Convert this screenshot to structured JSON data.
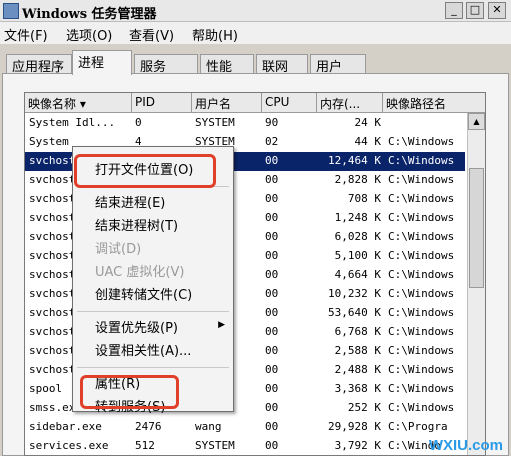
{
  "window": {
    "title": "Windows 任务管理器"
  },
  "menubar": [
    "文件(F)",
    "选项(O)",
    "查看(V)",
    "帮助(H)"
  ],
  "tabs": [
    "应用程序",
    "进程",
    "服务",
    "性能",
    "联网",
    "用户"
  ],
  "active_tab": "进程",
  "columns": [
    "映像名称",
    "PID",
    "用户名",
    "CPU",
    "内存(...",
    "映像路径名"
  ],
  "rows": [
    {
      "name": "System Idl...",
      "pid": "0",
      "user": "SYSTEM",
      "cpu": "90",
      "mem": "24 K",
      "path": ""
    },
    {
      "name": "System",
      "pid": "4",
      "user": "SYSTEM",
      "cpu": "02",
      "mem": "44 K",
      "path": "C:\\Windows"
    },
    {
      "name": "svchost",
      "pid": "",
      "user": "M",
      "cpu": "00",
      "mem": "12,464 K",
      "path": "C:\\Windows"
    },
    {
      "name": "svchost",
      "pid": "",
      "user": "",
      "cpu": "00",
      "mem": "2,828 K",
      "path": "C:\\Windows"
    },
    {
      "name": "svchost",
      "pid": "",
      "user": "M",
      "cpu": "00",
      "mem": "708 K",
      "path": "C:\\Windows"
    },
    {
      "name": "svchost",
      "pid": "",
      "user": "",
      "cpu": "00",
      "mem": "1,248 K",
      "path": "C:\\Windows"
    },
    {
      "name": "svchost",
      "pid": "",
      "user": "",
      "cpu": "00",
      "mem": "6,028 K",
      "path": "C:\\Windows"
    },
    {
      "name": "svchost",
      "pid": "",
      "user": "",
      "cpu": "00",
      "mem": "5,100 K",
      "path": "C:\\Windows"
    },
    {
      "name": "svchost",
      "pid": "",
      "user": "",
      "cpu": "00",
      "mem": "4,664 K",
      "path": "C:\\Windows"
    },
    {
      "name": "svchost",
      "pid": "",
      "user": "M",
      "cpu": "00",
      "mem": "10,232 K",
      "path": "C:\\Windows"
    },
    {
      "name": "svchost",
      "pid": "",
      "user": "M",
      "cpu": "00",
      "mem": "53,640 K",
      "path": "C:\\Windows"
    },
    {
      "name": "svchost",
      "pid": "",
      "user": "",
      "cpu": "00",
      "mem": "6,768 K",
      "path": "C:\\Windows"
    },
    {
      "name": "svchost",
      "pid": "",
      "user": "",
      "cpu": "00",
      "mem": "2,588 K",
      "path": "C:\\Windows"
    },
    {
      "name": "svchost",
      "pid": "",
      "user": "",
      "cpu": "00",
      "mem": "2,488 K",
      "path": "C:\\Windows"
    },
    {
      "name": "spool",
      "pid": "",
      "user": "M",
      "cpu": "00",
      "mem": "3,368 K",
      "path": "C:\\Windows"
    },
    {
      "name": "smss.ex",
      "pid": "264",
      "user": "",
      "cpu": "00",
      "mem": "252 K",
      "path": "C:\\Windows"
    },
    {
      "name": "sidebar.exe",
      "pid": "2476",
      "user": "wang",
      "cpu": "00",
      "mem": "29,928 K",
      "path": "C:\\Progra"
    },
    {
      "name": "services.exe",
      "pid": "512",
      "user": "SYSTEM",
      "cpu": "00",
      "mem": "3,792 K",
      "path": "C:\\Windo"
    }
  ],
  "context_menu": [
    {
      "label": "打开文件位置(O)",
      "disabled": false
    },
    {
      "sep": true
    },
    {
      "label": "结束进程(E)",
      "disabled": false
    },
    {
      "label": "结束进程树(T)",
      "disabled": false
    },
    {
      "label": "调试(D)",
      "disabled": true
    },
    {
      "label": "UAC 虚拟化(V)",
      "disabled": true
    },
    {
      "label": "创建转储文件(C)",
      "disabled": false
    },
    {
      "sep": true
    },
    {
      "label": "设置优先级(P)",
      "disabled": false,
      "submenu": true
    },
    {
      "label": "设置相关性(A)...",
      "disabled": false
    },
    {
      "sep": true
    },
    {
      "label": "属性(R)",
      "disabled": false
    },
    {
      "label": "转到服务(S)",
      "disabled": false
    }
  ],
  "watermark": "WXIU.com",
  "colors": {
    "selection": "#0a246a",
    "highlight_box": "#e0402a",
    "watermark": "#2b9be8"
  }
}
